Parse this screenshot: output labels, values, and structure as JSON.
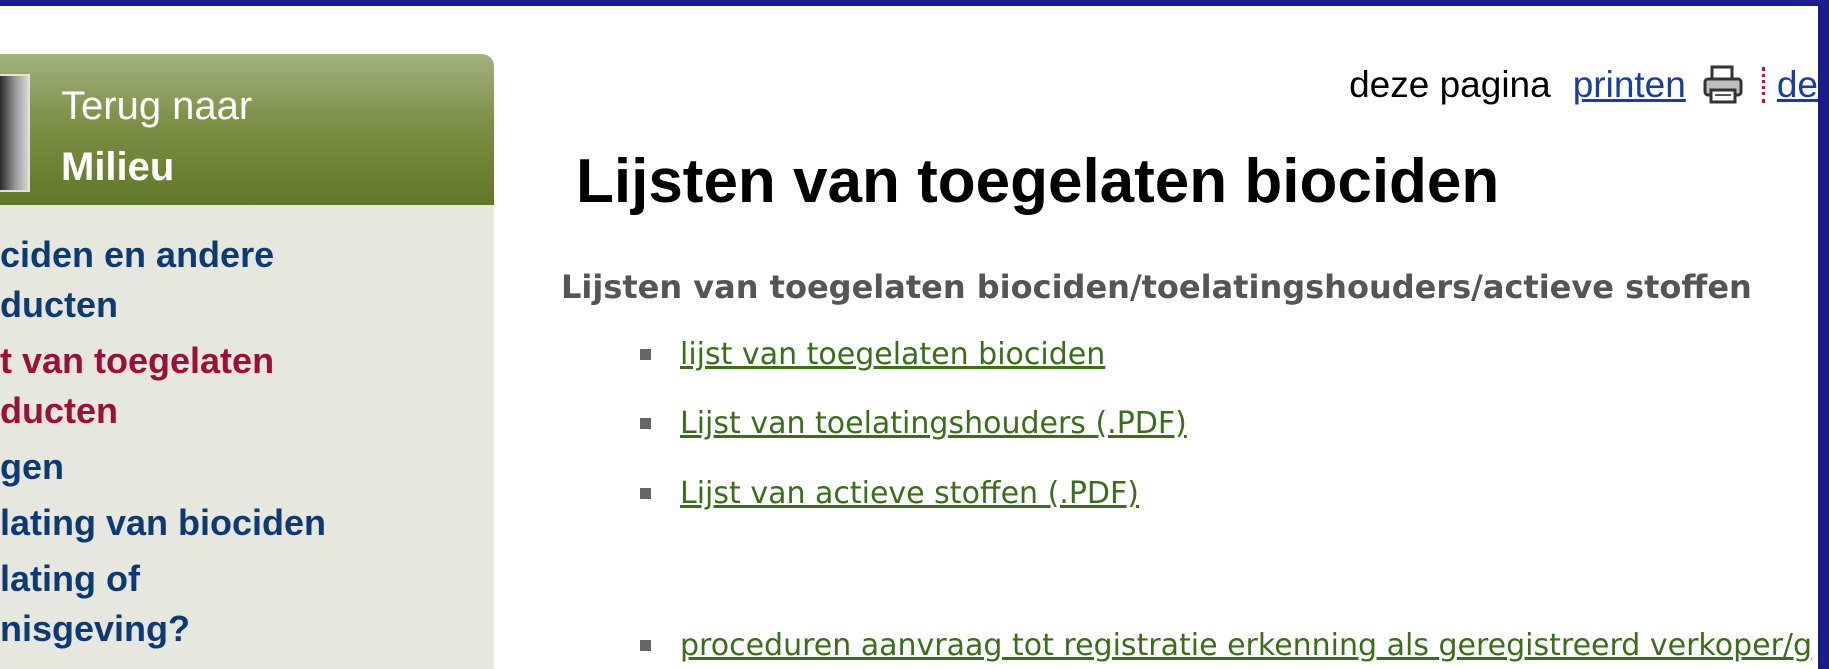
{
  "sidebar": {
    "back_label": "Terug naar",
    "back_target": "Milieu",
    "items": [
      {
        "label": "ciden en andere\nducten",
        "active": false
      },
      {
        "label": "t van toegelaten\nducten",
        "active": true
      },
      {
        "label": "gen",
        "active": false
      },
      {
        "label": "lating van biociden",
        "active": false
      },
      {
        "label": "lating of\nnisgeving?",
        "active": false
      }
    ]
  },
  "toolbar": {
    "print_text": "deze pagina",
    "print_link": "printen",
    "print_icon": "printer-icon",
    "next_link_partial": "de"
  },
  "main": {
    "title": "Lijsten van toegelaten biociden",
    "section_heading": "Lijsten van toegelaten biociden/toelatingshouders/actieve stoffen",
    "links": [
      {
        "label": "lijst van toegelaten biociden"
      },
      {
        "label": "Lijst van toelatingshouders (.PDF)"
      },
      {
        "label": "Lijst van actieve stoffen (.PDF)"
      },
      {
        "label": "proceduren aanvraag tot registratie erkenning als geregistreerd verkoper/g"
      }
    ]
  },
  "colors": {
    "frame": "#1c1c8e",
    "sidebar_bg": "#e6e7df",
    "header_green": "#6b8232",
    "nav_link": "#0d3a73",
    "nav_active": "#9b0f38",
    "content_link": "#3b6d1d",
    "print_link": "#1a3da3"
  }
}
